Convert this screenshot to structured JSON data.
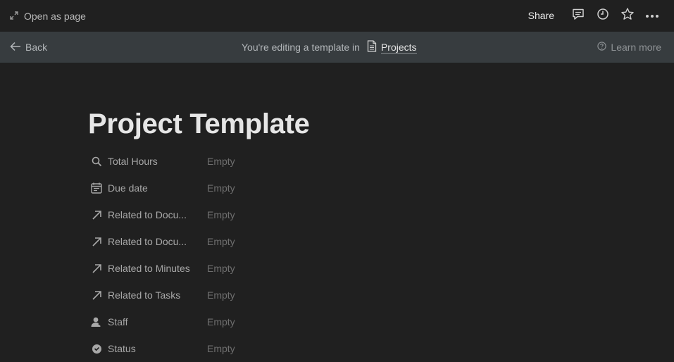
{
  "topbar": {
    "open_as_page": "Open as page",
    "share": "Share",
    "icons": [
      "expand-icon",
      "comment-icon",
      "clock-icon",
      "star-icon",
      "more-icon"
    ]
  },
  "banner": {
    "back": "Back",
    "editing_text": "You're editing a template in",
    "database_name": "Projects",
    "learn_more": "Learn more"
  },
  "page": {
    "title": "Project Template",
    "properties": [
      {
        "icon": "search-icon",
        "name": "Total Hours",
        "value": "Empty"
      },
      {
        "icon": "calendar-icon",
        "name": "Due date",
        "value": "Empty"
      },
      {
        "icon": "relation-arrow-icon",
        "name": "Related to Docu...",
        "value": "Empty"
      },
      {
        "icon": "relation-arrow-icon",
        "name": "Related to Docu...",
        "value": "Empty"
      },
      {
        "icon": "relation-arrow-icon",
        "name": "Related to Minutes",
        "value": "Empty"
      },
      {
        "icon": "relation-arrow-icon",
        "name": "Related to Tasks",
        "value": "Empty"
      },
      {
        "icon": "person-icon",
        "name": "Staff",
        "value": "Empty"
      },
      {
        "icon": "status-icon",
        "name": "Status",
        "value": "Empty"
      }
    ]
  },
  "colors": {
    "background": "#202020",
    "banner": "#373c3f",
    "title": "#e6e6e6",
    "muted": "#6f6f6f"
  }
}
